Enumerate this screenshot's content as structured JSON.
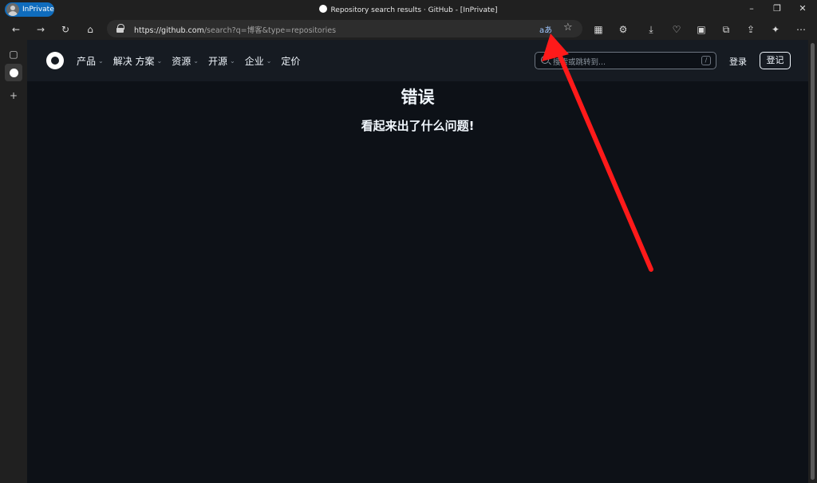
{
  "window": {
    "title": "Repository search results · GitHub - [InPrivate]",
    "inprivate_label": "InPrivate"
  },
  "browser": {
    "url_host": "https://github.com",
    "url_path": "/search?q=博客&type=repositories",
    "translate_glyph": "aあ"
  },
  "github": {
    "nav": [
      {
        "label": "产品",
        "dropdown": true
      },
      {
        "label": "解决 方案",
        "dropdown": true
      },
      {
        "label": "资源",
        "dropdown": true
      },
      {
        "label": "开源",
        "dropdown": true
      },
      {
        "label": "企业",
        "dropdown": true
      },
      {
        "label": "定价",
        "dropdown": false
      }
    ],
    "search_placeholder": "搜索或跳转到...",
    "search_shortcut": "/",
    "signin_label": "登录",
    "signup_label": "登记"
  },
  "error": {
    "title": "错误",
    "message": "看起来出了什么问题!"
  },
  "colors": {
    "page_bg": "#0d1117",
    "header_bg": "#161b22",
    "annotation_arrow": "#ff1a1a",
    "inprivate_badge": "#0f6cbd"
  }
}
